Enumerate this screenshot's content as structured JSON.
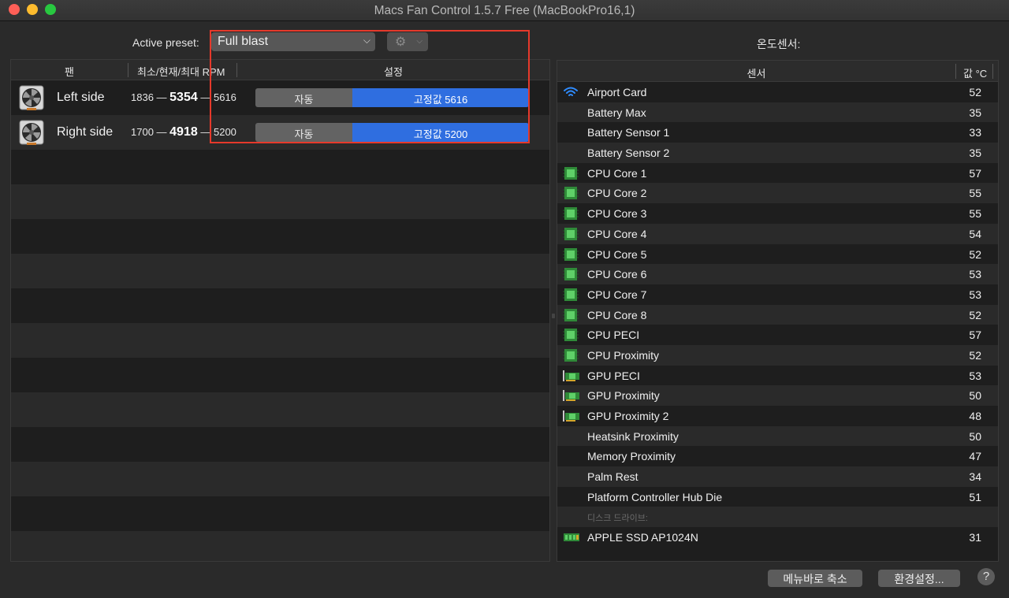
{
  "window": {
    "title": "Macs Fan Control 1.5.7 Free (MacBookPro16,1)"
  },
  "preset": {
    "label": "Active preset:",
    "selected": "Full blast"
  },
  "fans": {
    "columns": {
      "fan": "팬",
      "rpm": "최소/현재/최대 RPM",
      "setting": "설정"
    },
    "items": [
      {
        "name": "Left side",
        "min": "1836",
        "current": "5354",
        "max": "5616",
        "auto_label": "자동",
        "fixed_label": "고정값 5616"
      },
      {
        "name": "Right side",
        "min": "1700",
        "current": "4918",
        "max": "5200",
        "auto_label": "자동",
        "fixed_label": "고정값 5200"
      }
    ]
  },
  "sensors": {
    "heading": "온도센서:",
    "columns": {
      "sensor": "센서",
      "value": "값 °C"
    },
    "items": [
      {
        "name": "Airport Card",
        "value": "52",
        "icon": "wifi-icon"
      },
      {
        "name": "Battery Max",
        "value": "35",
        "icon": ""
      },
      {
        "name": "Battery Sensor 1",
        "value": "33",
        "icon": ""
      },
      {
        "name": "Battery Sensor 2",
        "value": "35",
        "icon": ""
      },
      {
        "name": "CPU Core 1",
        "value": "57",
        "icon": "cpu-chip-icon"
      },
      {
        "name": "CPU Core 2",
        "value": "55",
        "icon": "cpu-chip-icon"
      },
      {
        "name": "CPU Core 3",
        "value": "55",
        "icon": "cpu-chip-icon"
      },
      {
        "name": "CPU Core 4",
        "value": "54",
        "icon": "cpu-chip-icon"
      },
      {
        "name": "CPU Core 5",
        "value": "52",
        "icon": "cpu-chip-icon"
      },
      {
        "name": "CPU Core 6",
        "value": "53",
        "icon": "cpu-chip-icon"
      },
      {
        "name": "CPU Core 7",
        "value": "53",
        "icon": "cpu-chip-icon"
      },
      {
        "name": "CPU Core 8",
        "value": "52",
        "icon": "cpu-chip-icon"
      },
      {
        "name": "CPU PECI",
        "value": "57",
        "icon": "cpu-chip-icon"
      },
      {
        "name": "CPU Proximity",
        "value": "52",
        "icon": "cpu-chip-icon"
      },
      {
        "name": "GPU PECI",
        "value": "53",
        "icon": "gpu-card-icon"
      },
      {
        "name": "GPU Proximity",
        "value": "50",
        "icon": "gpu-card-icon"
      },
      {
        "name": "GPU Proximity 2",
        "value": "48",
        "icon": "gpu-card-icon"
      },
      {
        "name": "Heatsink Proximity",
        "value": "50",
        "icon": ""
      },
      {
        "name": "Memory Proximity",
        "value": "47",
        "icon": ""
      },
      {
        "name": "Palm Rest",
        "value": "34",
        "icon": ""
      },
      {
        "name": "Platform Controller Hub Die",
        "value": "51",
        "icon": ""
      },
      {
        "name": "디스크 드라이브:",
        "value": "",
        "icon": "",
        "group": true
      },
      {
        "name": "APPLE SSD AP1024N",
        "value": "31",
        "icon": "ssd-icon"
      }
    ]
  },
  "buttons": {
    "minimize_to_menubar": "메뉴바로 축소",
    "preferences": "환경설정...",
    "help": "?"
  },
  "colors": {
    "accent_blue": "#2f6ee0",
    "chip_green": "#3aa845",
    "highlight_red": "#e6392b"
  }
}
